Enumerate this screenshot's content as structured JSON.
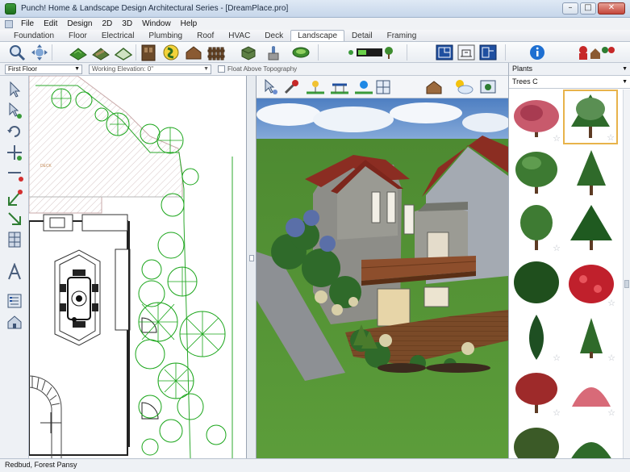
{
  "window": {
    "title": "Punch! Home & Landscape Design Architectural Series - [DreamPlace.pro]"
  },
  "window_controls": {
    "minimize": "–",
    "maximize": "□",
    "close": "✕"
  },
  "menu": [
    "File",
    "Edit",
    "Design",
    "2D",
    "3D",
    "Window",
    "Help"
  ],
  "tabs": [
    "Foundation",
    "Floor",
    "Electrical",
    "Plumbing",
    "Roof",
    "HVAC",
    "Deck",
    "Landscape",
    "Detail",
    "Framing"
  ],
  "active_tab": "Landscape",
  "subbar": {
    "floor": "First Floor",
    "elevation": "Working Elevation: 0\"",
    "float_label": "Float Above Topography"
  },
  "plan": {
    "label_deck": "DECK"
  },
  "library": {
    "category": "Plants",
    "subcategory": "Trees C"
  },
  "status": "Redbud, Forest Pansy",
  "icons": {
    "toolbar": [
      "magnifier-icon",
      "move-icon",
      "terrain-icon",
      "path-icon",
      "plot-icon",
      "fence-icon",
      "shape-icon",
      "mulch-icon",
      "lawn-icon",
      "planter-icon",
      "info-icon",
      "people-icon"
    ],
    "palette": [
      "select-arrow-icon",
      "select-plus-icon",
      "rotate-icon",
      "add-icon",
      "line-icon",
      "arc-icon",
      "polyline-icon",
      "grid-icon",
      "text-icon",
      "layers-icon",
      "house-icon"
    ]
  },
  "colors": {
    "grass": "#4f8e35",
    "sky": "#5b86c4",
    "plan_green": "#19a519",
    "selection": "#e8b34a"
  }
}
